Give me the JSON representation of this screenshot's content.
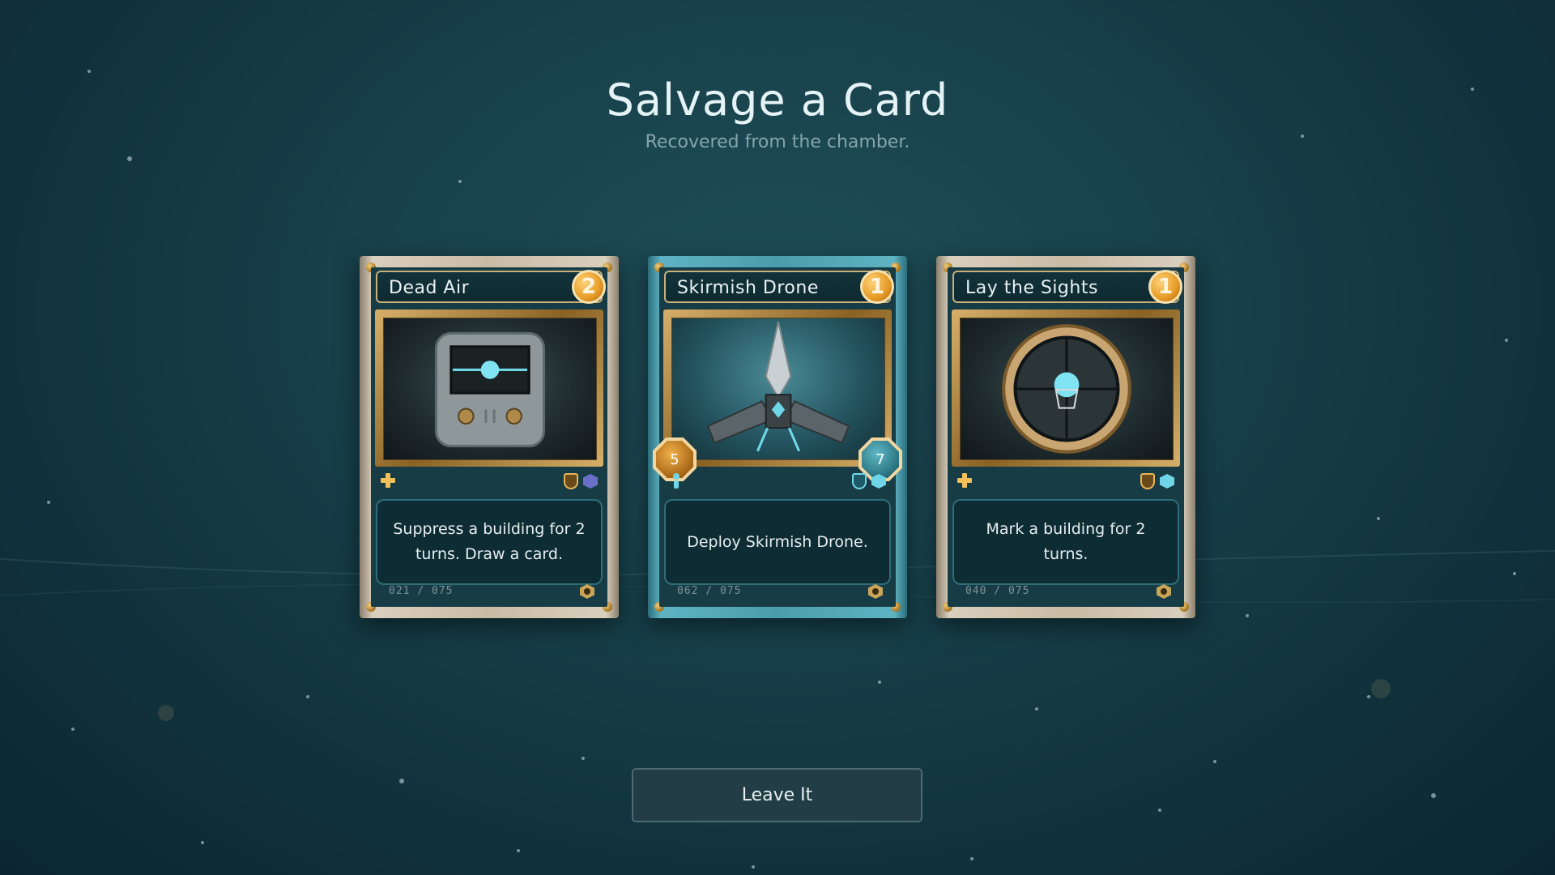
{
  "header": {
    "title": "Salvage a Card",
    "subtitle": "Recovered from the chamber."
  },
  "cards": [
    {
      "name": "Dead Air",
      "cost": "2",
      "description": "Suppress a building for 2 turns. Draw a card.",
      "serial": "021 / 075",
      "frame": "bronze",
      "art_icon": "radio-device-icon",
      "type_icon": "plus-icon",
      "tag_icons": [
        "shield-icon",
        "hex-icon"
      ]
    },
    {
      "name": "Skirmish Drone",
      "cost": "1",
      "description": "Deploy Skirmish Drone.",
      "serial": "062 / 075",
      "frame": "teal",
      "art_icon": "drone-icon",
      "type_icon": "unit-icon",
      "tag_icons": [
        "shield-icon",
        "hex-icon"
      ],
      "attack": "5",
      "health": "7"
    },
    {
      "name": "Lay the Sights",
      "cost": "1",
      "description": "Mark a building for 2 turns.",
      "serial": "040 / 075",
      "frame": "bronze",
      "art_icon": "scope-icon",
      "type_icon": "plus-icon",
      "tag_icons": [
        "shield-icon",
        "hex-icon"
      ]
    }
  ],
  "actions": {
    "leave_label": "Leave It"
  },
  "colors": {
    "background": "#17404a",
    "accent_gold": "#e69a26",
    "accent_teal": "#5fb3c2"
  }
}
